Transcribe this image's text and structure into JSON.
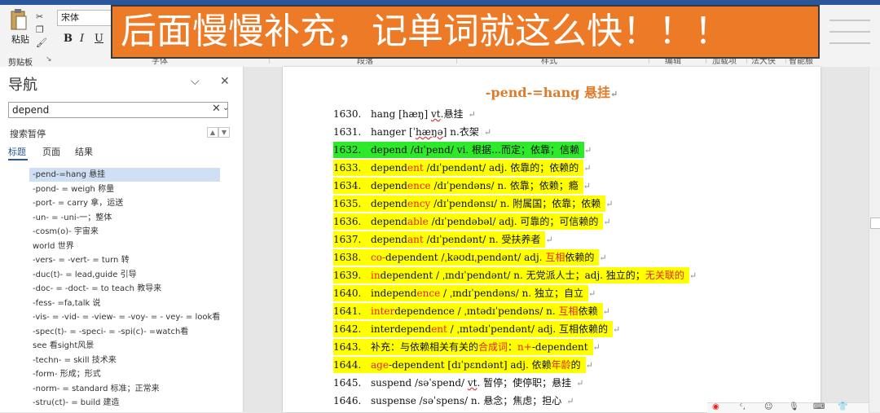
{
  "ribbon": {
    "paste_label": "粘贴",
    "clipboard_label": "剪贴板",
    "font_name": "宋体",
    "bold": "B",
    "italic": "I",
    "underline": "U",
    "group_labels": [
      "字体",
      "段落",
      "样式",
      "编辑",
      "加载项",
      "法大侠",
      "智能服"
    ]
  },
  "caption": "后面慢慢补充，记单词就这么快！！！",
  "nav": {
    "title": "导航",
    "search_value": "depend",
    "search_status": "搜索暂停",
    "tabs": [
      "标题",
      "页面",
      "结果"
    ],
    "headings": [
      "-pend-=hang 悬挂",
      "-pond- = weigh 称量",
      "-port- = carry 拿，运送",
      "-un- = -uni-一；整体",
      "-cosm(o)- 宇宙来",
      "world 世界",
      "-vers- = -vert- = turn 转",
      "-duc(t)- = lead,guide 引导",
      "-doc- = -doct- = to teach 教导来",
      "-fess- =fa,talk 说",
      "-vis- = -vid- = -view- = -voy- = - vey- = look看",
      "-spec(t)- = -speci- = -spi(c)- =watch看",
      "see 看sight风景",
      "-techn- = skill 技术来",
      "-form- 形成；形式",
      "-norm- = standard 标准；正常来",
      "-stru(ct)- = build 建造"
    ]
  },
  "document": {
    "title": "-pend-=hang  悬挂",
    "entries": [
      {
        "num": "1630.",
        "parts": [
          [
            "hang [hæŋ] ",
            ""
          ],
          [
            "vt",
            "u"
          ],
          [
            ".悬挂",
            ""
          ]
        ],
        "hl": ""
      },
      {
        "num": "1631.",
        "parts": [
          [
            "hanger [ˈ",
            ""
          ],
          [
            "hæŋə",
            "u"
          ],
          [
            "] n.衣架",
            ""
          ]
        ],
        "hl": ""
      },
      {
        "num": "1632.",
        "parts": [
          [
            "depend /dɪˈpend/ vi.  根据…而定；依靠；信赖",
            ""
          ]
        ],
        "hl": "#2ee82a"
      },
      {
        "num": "1633.",
        "parts": [
          [
            "depend",
            ""
          ],
          [
            "ent",
            "r"
          ],
          [
            " /dɪˈpendənt/ adj.  依靠的；依赖的",
            ""
          ]
        ],
        "hl": "#ffff00"
      },
      {
        "num": "1634.",
        "parts": [
          [
            "depend",
            ""
          ],
          [
            "ence",
            "r"
          ],
          [
            " /dɪˈpendəns/ n.  依靠；依赖；瘾",
            ""
          ]
        ],
        "hl": "#ffff00"
      },
      {
        "num": "1635.",
        "parts": [
          [
            "depend",
            ""
          ],
          [
            "ency",
            "r"
          ],
          [
            " /dɪˈpendənsɪ/ n.  附属国；依靠；依赖",
            ""
          ]
        ],
        "hl": "#ffff00"
      },
      {
        "num": "1636.",
        "parts": [
          [
            "depend",
            ""
          ],
          [
            "able",
            "r"
          ],
          [
            " /dɪˈpendəbəl/ adj.  可靠的；可信赖的",
            ""
          ]
        ],
        "hl": "#ffff00"
      },
      {
        "num": "1637.",
        "parts": [
          [
            "depend",
            ""
          ],
          [
            "ant",
            "r"
          ],
          [
            " /dɪˈpendənt/ n.  受扶养者",
            ""
          ]
        ],
        "hl": "#ffff00"
      },
      {
        "num": "1638.",
        "parts": [
          [
            "co-",
            "r"
          ],
          [
            "dependent /ˌkəʊdɪˌpendənt/ adj.  ",
            ""
          ],
          [
            "互相",
            "r"
          ],
          [
            "依赖的",
            ""
          ]
        ],
        "hl": "#ffff00"
      },
      {
        "num": "1639.",
        "parts": [
          [
            "in",
            "r"
          ],
          [
            "dependent / ˌɪndɪˈpendənt/ n.  无党派人士；adj.  独立的；",
            ""
          ],
          [
            "无关联的",
            "r"
          ]
        ],
        "hl": "#ffff00"
      },
      {
        "num": "1640.",
        "parts": [
          [
            "independ",
            ""
          ],
          [
            "ence",
            "r"
          ],
          [
            " / ˌɪndɪˈpendəns/ n.  独立；自立",
            ""
          ]
        ],
        "hl": "#ffff00"
      },
      {
        "num": "1641.",
        "parts": [
          [
            "inter",
            "r"
          ],
          [
            "dependence / ˌɪntədɪˈpendəns/ n.  ",
            ""
          ],
          [
            "互相",
            "r"
          ],
          [
            "依赖",
            ""
          ]
        ],
        "hl": "#ffff00"
      },
      {
        "num": "1642.",
        "parts": [
          [
            "interdepend",
            ""
          ],
          [
            "ent",
            "r"
          ],
          [
            " / ˌɪntədɪˈpendənt/ adj.  互相依赖的",
            ""
          ]
        ],
        "hl": "#ffff00"
      },
      {
        "num": "1643.",
        "parts": [
          [
            "补充：与依赖相关有关的",
            ""
          ],
          [
            "合成词",
            "r"
          ],
          [
            "：",
            ""
          ],
          [
            "n+",
            "r"
          ],
          [
            "-dependent",
            ""
          ]
        ],
        "hl": "#ffff00"
      },
      {
        "num": "1644.",
        "parts": [
          [
            "age",
            "r"
          ],
          [
            "-dependent [dɪˈpɛndənt] adj.  依赖",
            ""
          ],
          [
            "年龄",
            "r"
          ],
          [
            "的",
            ""
          ]
        ],
        "hl": "#ffff00"
      },
      {
        "num": "1645.",
        "parts": [
          [
            "suspend /səˈspend/ ",
            ""
          ],
          [
            "vt",
            "u"
          ],
          [
            ".  暂停；使停职；悬挂",
            ""
          ]
        ],
        "hl": ""
      },
      {
        "num": "1646.",
        "parts": [
          [
            "suspense /səˈspens/ n.  悬念；焦虑；担心",
            ""
          ]
        ],
        "hl": ""
      }
    ]
  },
  "colors": {
    "caption_bg": "#ed7a27",
    "title_color": "#e07b2a",
    "highlight_green": "#2ee82a",
    "highlight_yellow": "#ffff00",
    "root_red": "#e8231c"
  }
}
